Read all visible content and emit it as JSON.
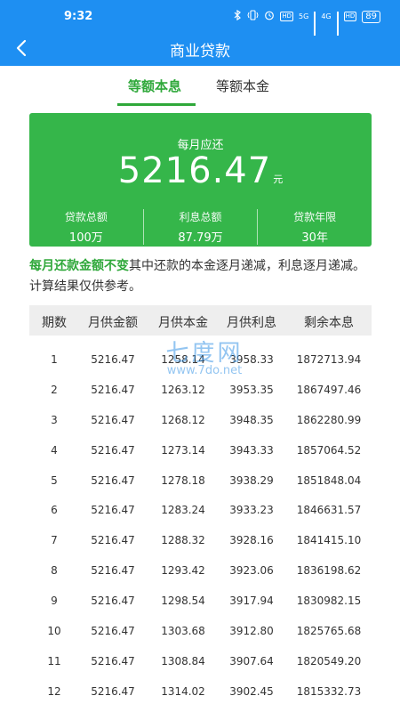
{
  "status_bar": {
    "time": "9:32",
    "network_1": "5G",
    "network_2": "4G",
    "battery": "89",
    "icons": [
      "bluetooth-icon",
      "vibrate-icon",
      "alarm-icon",
      "hd-icon",
      "signal-icon",
      "signal-icon",
      "hd-icon"
    ]
  },
  "nav": {
    "title": "商业贷款"
  },
  "tabs": [
    {
      "label": "等额本息",
      "active": true
    },
    {
      "label": "等额本金",
      "active": false
    }
  ],
  "summary": {
    "label": "每月应还",
    "amount": "5216.47",
    "unit": "元",
    "stats": [
      {
        "label": "贷款总额",
        "value": "100万"
      },
      {
        "label": "利息总额",
        "value": "87.79万"
      },
      {
        "label": "贷款年限",
        "value": "30年"
      }
    ]
  },
  "note": {
    "highlight": "每月还款金额不变",
    "text": "其中还款的本金逐月递减，利息逐月递减。计算结果仅供参考。"
  },
  "table": {
    "headers": [
      "期数",
      "月供金额",
      "月供本金",
      "月供利息",
      "剩余本息"
    ],
    "rows": [
      [
        "1",
        "5216.47",
        "1258.14",
        "3958.33",
        "1872713.94"
      ],
      [
        "2",
        "5216.47",
        "1263.12",
        "3953.35",
        "1867497.46"
      ],
      [
        "3",
        "5216.47",
        "1268.12",
        "3948.35",
        "1862280.99"
      ],
      [
        "4",
        "5216.47",
        "1273.14",
        "3943.33",
        "1857064.52"
      ],
      [
        "5",
        "5216.47",
        "1278.18",
        "3938.29",
        "1851848.04"
      ],
      [
        "6",
        "5216.47",
        "1283.24",
        "3933.23",
        "1846631.57"
      ],
      [
        "7",
        "5216.47",
        "1288.32",
        "3928.16",
        "1841415.10"
      ],
      [
        "8",
        "5216.47",
        "1293.42",
        "3923.06",
        "1836198.62"
      ],
      [
        "9",
        "5216.47",
        "1298.54",
        "3917.94",
        "1830982.15"
      ],
      [
        "10",
        "5216.47",
        "1303.68",
        "3912.80",
        "1825765.68"
      ],
      [
        "11",
        "5216.47",
        "1308.84",
        "3907.64",
        "1820549.20"
      ],
      [
        "12",
        "5216.47",
        "1314.02",
        "3902.45",
        "1815332.73"
      ]
    ]
  },
  "watermark": {
    "big": "七度网",
    "small": "www.7do.net"
  },
  "colors": {
    "primary_blue": "#1e8ff2",
    "accent_green": "#35b64a",
    "highlight_green": "#2fa83a"
  }
}
